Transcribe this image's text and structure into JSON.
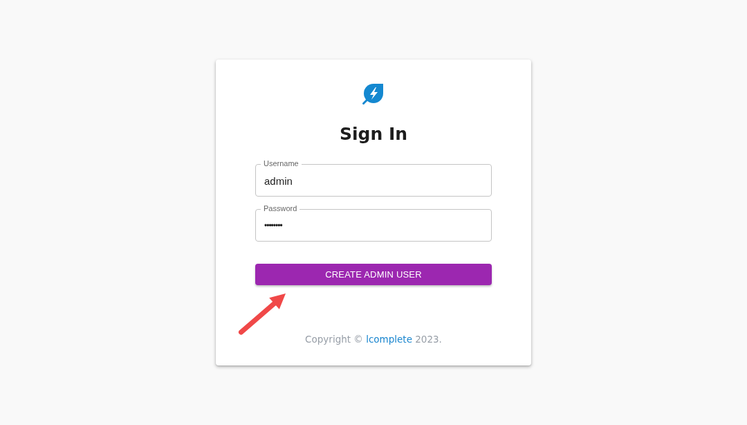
{
  "title": "Sign In",
  "fields": [
    {
      "kind": "text",
      "label": "Username",
      "value": "admin"
    },
    {
      "kind": "password",
      "label": "Password",
      "value": "••••••••"
    }
  ],
  "submit_button": {
    "label": "CREATE ADMIN USER"
  },
  "footer": {
    "text_before": "Copyright ©",
    "link": "lcomplete",
    "text_after": "2023."
  }
}
